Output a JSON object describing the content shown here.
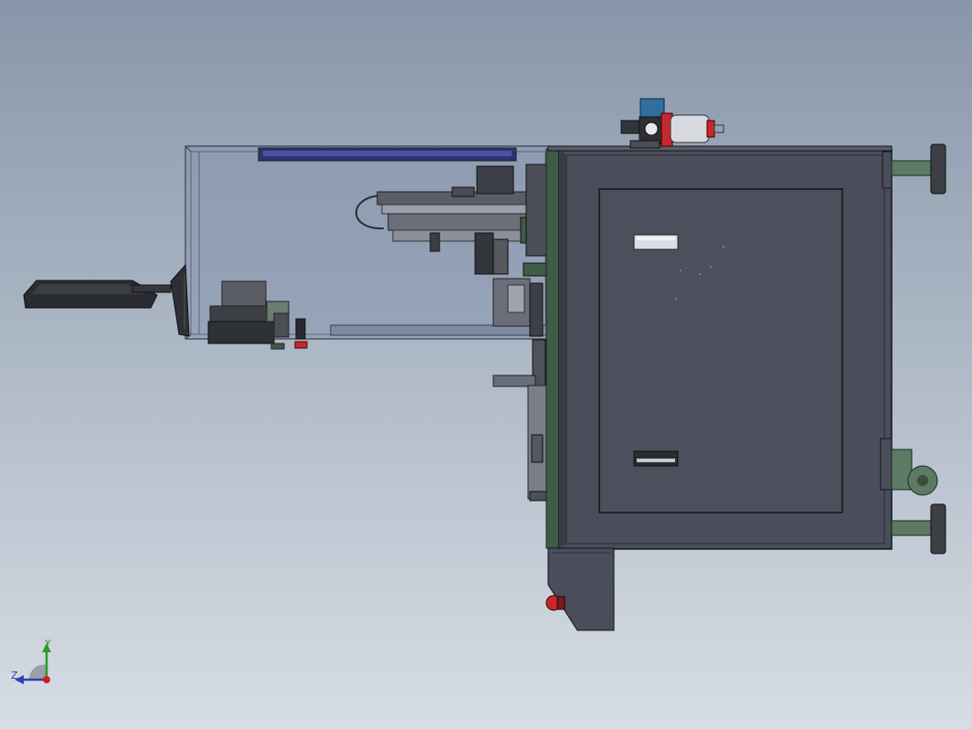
{
  "viewport": {
    "background_top": "#8796a9",
    "background_bottom": "#d7dde5"
  },
  "model": {
    "cabinet_color": "#4a4d5a",
    "cabinet_door_color": "#4d505c",
    "frame_dark": "#2c2e36",
    "enclosure_color": "#7d8aa8",
    "enclosure_edge": "#3a3e4c",
    "accent_green": "#3f5c46",
    "accent_red": "#c8282d",
    "accent_blue": "#2f6f9e",
    "light_bar_color": "#2e3470"
  },
  "triad": {
    "y_label": "Y",
    "z_label": "Z",
    "y_color": "#2e9a2e",
    "z_color": "#2f3fb5",
    "x_color": "#cc2222"
  }
}
